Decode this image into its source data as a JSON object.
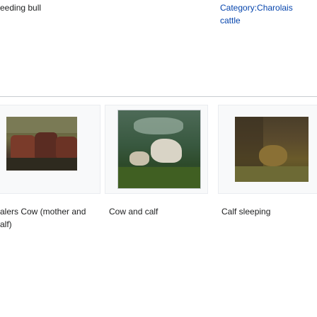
{
  "top_row": {
    "left_caption": "eeding bull",
    "right_caption_line1": "Category:Charolais",
    "right_caption_line2": "cattle"
  },
  "gallery": {
    "items": [
      {
        "caption_line1": "alers Cow (mother and",
        "caption_line2": "alf)",
        "thumbnail": "cattle-herd-image"
      },
      {
        "caption_line1": "Cow and calf",
        "thumbnail": "cow-and-calf-image"
      },
      {
        "caption_line1": "Calf sleeping",
        "thumbnail": "calf-sleeping-image"
      }
    ]
  },
  "colors": {
    "link": "#0645ad",
    "text": "#202122",
    "separator": "#c8ccd1",
    "box_background": "#f8f9fa"
  }
}
